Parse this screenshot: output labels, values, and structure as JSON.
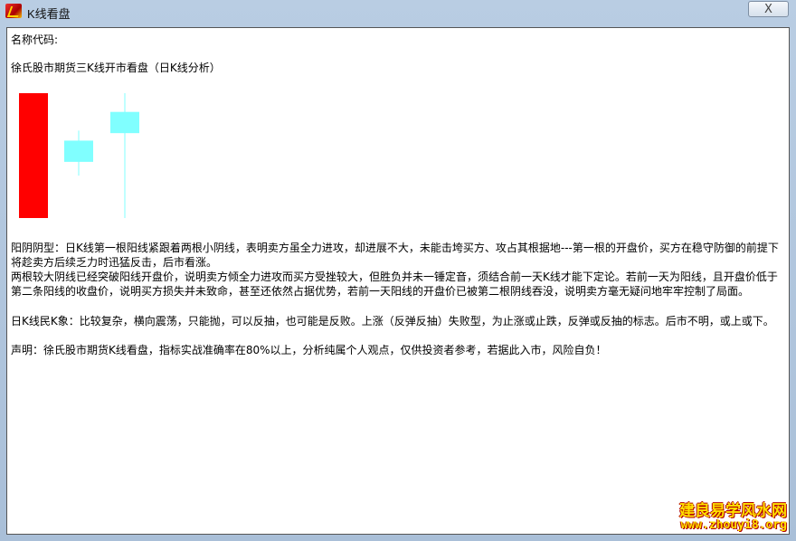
{
  "window": {
    "title": "K线看盘",
    "close_glyph": "X"
  },
  "content": {
    "name_code_label": "名称代码:",
    "heading": "徐氏股市期货三K线开市看盘（日K线分析）",
    "pattern_desc_1": "阳阴阴型：日K线第一根阳线紧跟着两根小阴线，表明卖方虽全力进攻，却进展不大，未能击垮买方、攻占其根据地---第一根的开盘价，买方在稳守防御的前提下将趁卖方后续乏力时迅猛反击，后市看涨。",
    "pattern_desc_2": "两根较大阴线已经突破阳线开盘价，说明卖方倾全力进攻而买方受挫较大，但胜负并未一锤定音，须结合前一天K线才能下定论。若前一天为阳线，且开盘价低于第二条阳线的收盘价，说明买方损失并未致命，甚至还依然占据优势，若前一天阳线的开盘价已被第二根阴线吞没，说明卖方毫无疑问地牢牢控制了局面。",
    "daily_k_desc": "日K线民K象：比较复杂，横向震荡，只能抛，可以反抽，也可能是反败。上涨（反弹反抽）失败型，为止涨或止跌，反弹或反抽的标志。后市不明，或上或下。",
    "disclaimer": "声明：徐氏股市期货K线看盘，指标实战准确率在80%以上，分析纯属个人观点，仅供投资者参考，若据此入市，风险自负！"
  },
  "candles": [
    {
      "open": 0,
      "close": 100,
      "high": 100,
      "low": 0,
      "color": "#ff0000"
    },
    {
      "open": 62,
      "close": 45,
      "high": 70,
      "low": 34,
      "color": "#80ffff"
    },
    {
      "open": 85,
      "close": 68,
      "high": 100,
      "low": 0,
      "color": "#80ffff"
    }
  ],
  "watermark": {
    "line1": "建良易学风水网",
    "line2": "www.zhouyi8.org"
  }
}
